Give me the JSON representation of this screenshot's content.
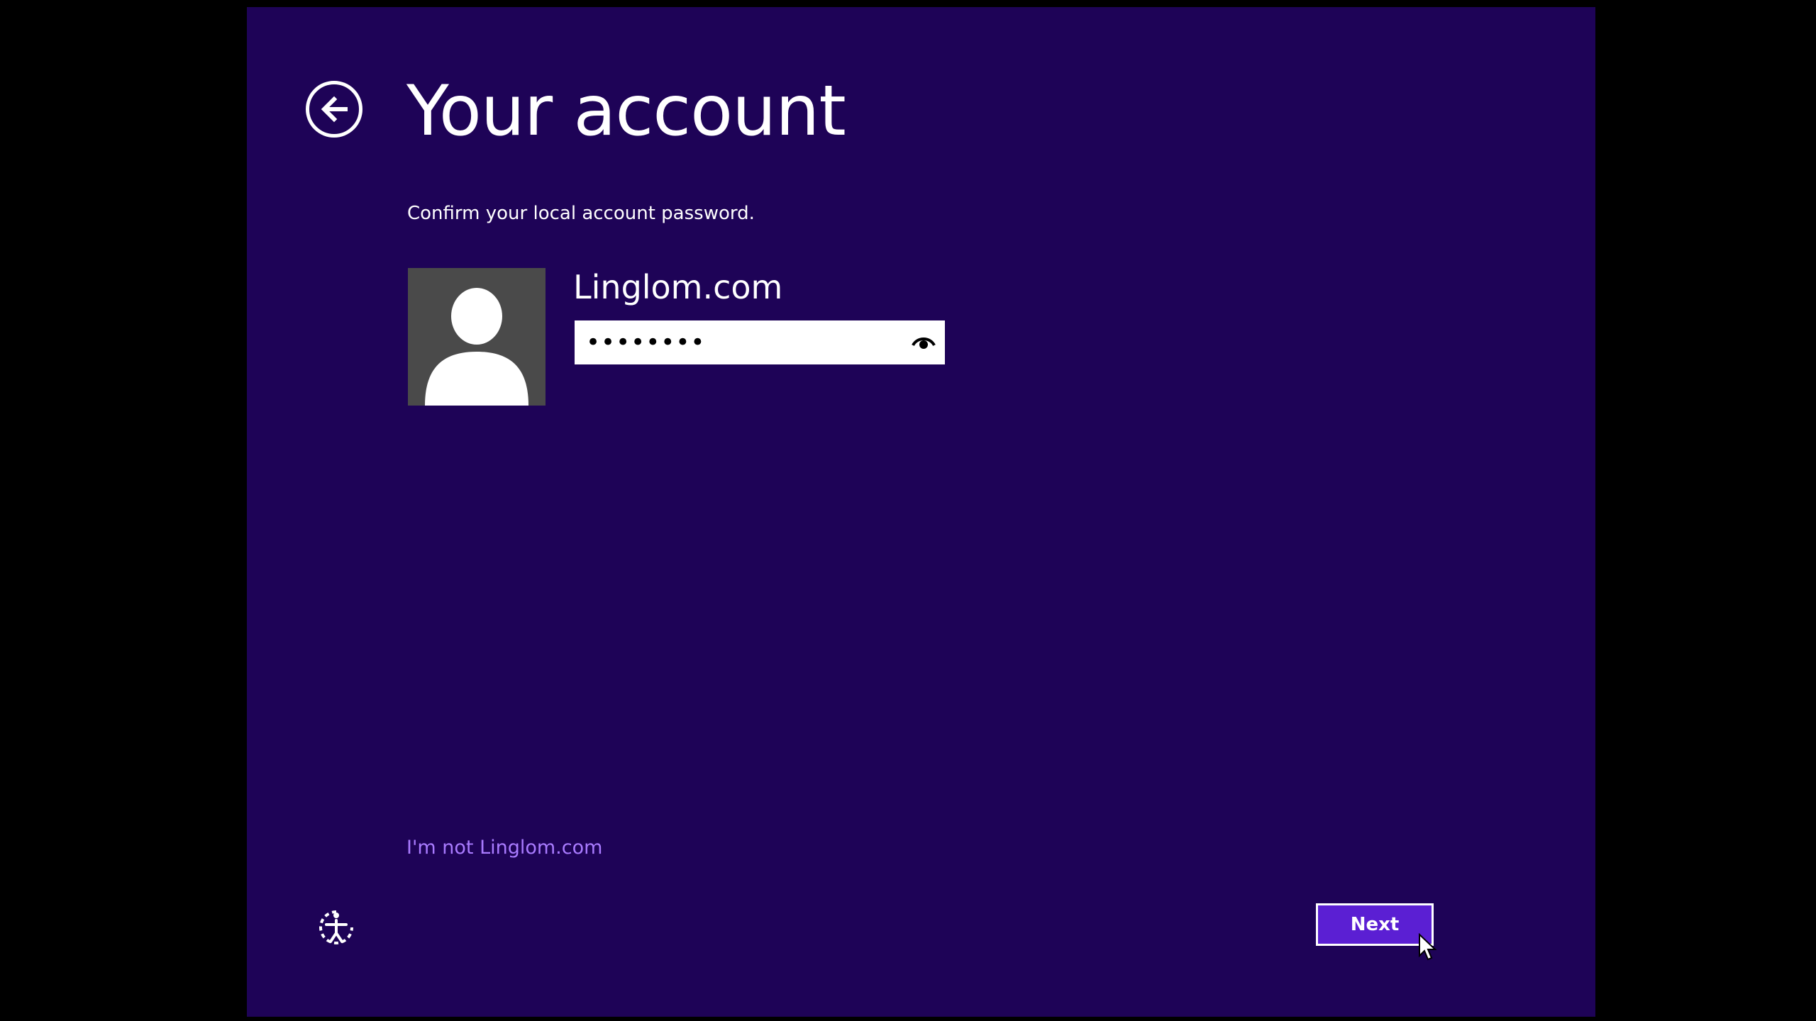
{
  "header": {
    "title": "Your account",
    "back_icon": "back-arrow-icon"
  },
  "subtitle": "Confirm your local account password.",
  "user": {
    "name": "Linglom.com",
    "avatar_icon": "default-user-avatar-icon"
  },
  "password": {
    "value": "••••••••",
    "reveal_icon": "eye-icon"
  },
  "links": {
    "not_user": "I'm not Linglom.com"
  },
  "footer": {
    "ease_of_access_icon": "ease-of-access-icon",
    "next_label": "Next"
  },
  "colors": {
    "background": "#1e0357",
    "accent_button": "#5b1fd3",
    "link": "#a97bff",
    "letterbox": "#000000"
  }
}
